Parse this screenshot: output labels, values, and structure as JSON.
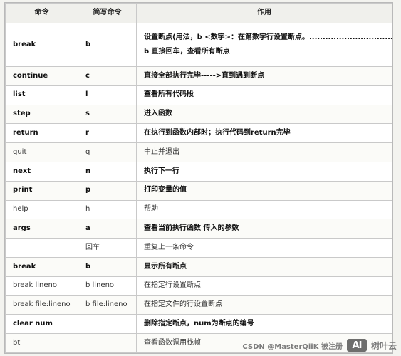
{
  "table": {
    "headers": [
      "命令",
      "简写命令",
      "作用"
    ],
    "rows": [
      {
        "command": "break",
        "short": "b",
        "desc_line1": "设置断点(用法，b <数字>：在第数字行设置断点。..........................................................)",
        "desc_line2": "b 直接回车，查看所有断点"
      },
      {
        "command": "continue",
        "short": "c",
        "desc": "直接全部执行完毕----->直到遇到断点"
      },
      {
        "command": "list",
        "short": "l",
        "desc": "查看所有代码段"
      },
      {
        "command": "step",
        "short": "s",
        "desc": "进入函数"
      },
      {
        "command": "return",
        "short": "r",
        "desc": "在执行到函数内部时；执行代码到return完毕"
      },
      {
        "command": "quit",
        "short": "q",
        "desc": "中止并退出"
      },
      {
        "command": "next",
        "short": "n",
        "desc": "执行下一行"
      },
      {
        "command": "print",
        "short": "p",
        "desc": "打印变量的值"
      },
      {
        "command": "help",
        "short": "h",
        "desc": "帮助"
      },
      {
        "command": "args",
        "short": "a",
        "desc": "查看当前执行函数 传入的参数"
      },
      {
        "command": "",
        "short": "回车",
        "desc": "重复上一条命令"
      },
      {
        "command": "break",
        "short": "b",
        "desc": "显示所有断点"
      },
      {
        "command": "break lineno",
        "short": "b lineno",
        "desc": "在指定行设置断点"
      },
      {
        "command": "break file:lineno",
        "short": "b file:lineno",
        "desc": "在指定文件的行设置断点"
      },
      {
        "command": "clear num",
        "short": "",
        "desc": "删除指定断点，num为断点的编号"
      },
      {
        "command": "bt",
        "short": "",
        "desc": "查看函数调用栈帧"
      }
    ]
  },
  "watermark": {
    "text": "CSDN @MasterQiiK 被注册",
    "logo": "AI",
    "site": "树叶云"
  }
}
